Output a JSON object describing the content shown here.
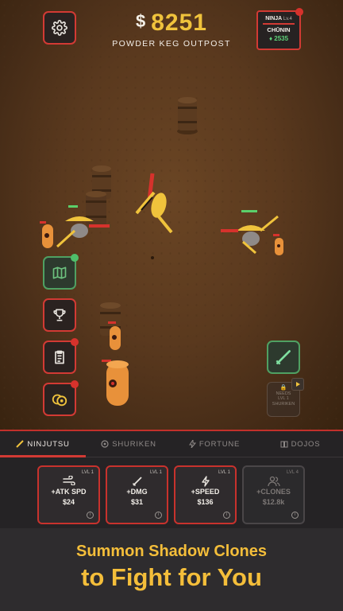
{
  "hud": {
    "cash_symbol": "$",
    "cash_amount": "8251",
    "location": "POWDER KEG OUTPOST",
    "rank_title": "NINJA",
    "rank_level": "Lv.4",
    "rank_name": "CHŪNIN",
    "gems": "2535"
  },
  "side_buttons": [
    "map-button",
    "trophy-button",
    "clipboard-button",
    "coins-button"
  ],
  "locked_skill": {
    "line1": "NEEDS",
    "line2": "LVL 1",
    "line3": "SHURIKEN"
  },
  "tabs": [
    {
      "label": "NINJUTSU",
      "active": true
    },
    {
      "label": "SHURIKEN",
      "active": false
    },
    {
      "label": "FORTUNE",
      "active": false
    },
    {
      "label": "DOJOS",
      "active": false
    }
  ],
  "upgrades": [
    {
      "level": "LVL 1",
      "name": "+ATK SPD",
      "price": "$24",
      "locked": false,
      "icon": "wind-icon"
    },
    {
      "level": "LVL 1",
      "name": "+DMG",
      "price": "$31",
      "locked": false,
      "icon": "sword-icon"
    },
    {
      "level": "LVL 1",
      "name": "+SPEED",
      "price": "$136",
      "locked": false,
      "icon": "lightning-icon"
    },
    {
      "level": "LVL 4",
      "name": "+CLONES",
      "price": "$12.8k",
      "locked": true,
      "icon": "people-icon"
    }
  ],
  "promo": {
    "line1": "Summon Shadow Clones",
    "line2": "to Fight for You"
  },
  "colors": {
    "accent_red": "#d23a34",
    "gold": "#f0c33c",
    "green": "#4fa062",
    "ground": "#5a391e"
  }
}
